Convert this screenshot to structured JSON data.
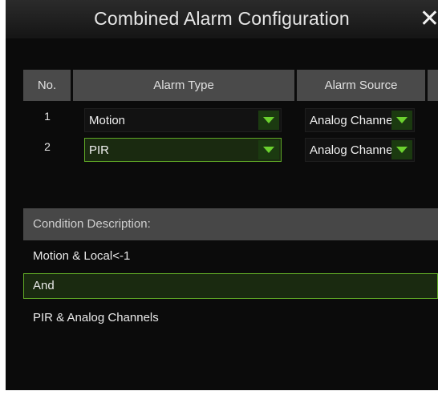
{
  "dialog": {
    "title": "Combined Alarm Configuration",
    "close_glyph": "✕"
  },
  "table": {
    "headers": {
      "no": "No.",
      "alarm_type": "Alarm Type",
      "alarm_source": "Alarm Source"
    },
    "rows": [
      {
        "no": "1",
        "alarm_type": "Motion",
        "alarm_source": "Analog Channels"
      },
      {
        "no": "2",
        "alarm_type": "PIR",
        "alarm_source": "Analog Channels"
      }
    ]
  },
  "condition": {
    "header": "Condition Description:",
    "lines": [
      "Motion & Local<-1",
      "And",
      "PIR & Analog Channels"
    ]
  },
  "colors": {
    "accent_green": "#5fa826",
    "arrow_green": "#6bd12e",
    "background": "#0b0b0b",
    "header_gray": "#4a4a4a"
  },
  "icons": {
    "close": "close-icon",
    "dropdown": "chevron-down-icon"
  }
}
